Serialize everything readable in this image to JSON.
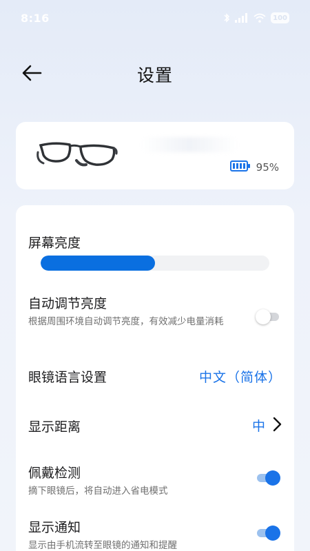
{
  "status_bar": {
    "time": "8:16",
    "battery_level": "100",
    "icons": [
      "bluetooth-icon",
      "signal-icon",
      "wifi-icon",
      "battery-icon"
    ]
  },
  "header": {
    "title": "设置",
    "back_icon": "arrow-left-icon"
  },
  "device": {
    "battery_percent": "95%",
    "battery_icon": "battery-icon",
    "image_icon": "glasses-icon"
  },
  "settings": {
    "brightness": {
      "label": "屏幕亮度",
      "level": 0.5
    },
    "auto_brightness": {
      "label": "自动调节亮度",
      "description": "根据周围环境自动调节亮度，有效减少电量消耗",
      "enabled": false
    },
    "language": {
      "label": "眼镜语言设置",
      "value": "中文（简体）"
    },
    "display_distance": {
      "label": "显示距离",
      "value": "中",
      "icon": "chevron-right-icon"
    },
    "wear_detection": {
      "label": "佩戴检测",
      "description": "摘下眼镜后，将自动进入省电模式",
      "enabled": true
    },
    "notifications": {
      "label": "显示通知",
      "description": "显示由手机流转至眼镜的通知和提醒",
      "enabled": true
    }
  },
  "colors": {
    "accent": "#1a73e8",
    "slider_fill": "#0a6fe0",
    "background": "#eef2fa"
  }
}
